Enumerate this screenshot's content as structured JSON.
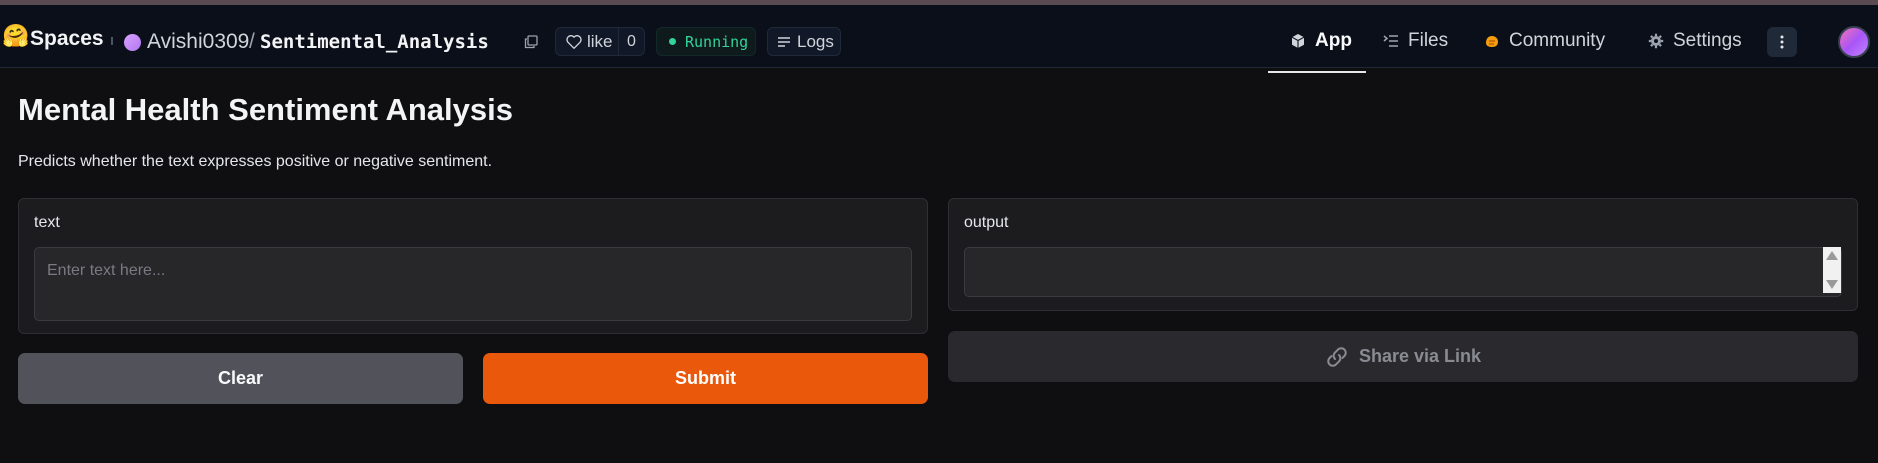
{
  "header": {
    "spaces_label": "Spaces",
    "owner": "Avishi0309",
    "separator": "/",
    "repo": "Sentimental_Analysis",
    "like_label": "like",
    "like_count": "0",
    "status": "Running",
    "logs_label": "Logs",
    "tabs": [
      {
        "label": "App",
        "icon": "cube-icon",
        "active": true
      },
      {
        "label": "Files",
        "icon": "files-icon",
        "active": false
      },
      {
        "label": "Community",
        "icon": "community-icon",
        "active": false
      },
      {
        "label": "Settings",
        "icon": "gear-icon",
        "active": false
      }
    ]
  },
  "main": {
    "title": "Mental Health Sentiment Analysis",
    "description": "Predicts whether the text expresses positive or negative sentiment.",
    "input": {
      "label": "text",
      "placeholder": "Enter text here...",
      "value": ""
    },
    "output": {
      "label": "output",
      "value": ""
    },
    "buttons": {
      "clear": "Clear",
      "submit": "Submit",
      "share": "Share via Link"
    }
  },
  "colors": {
    "background": "#0f0f11",
    "header_bg": "#0b0f19",
    "accent": "#ea580c",
    "running": "#34d399",
    "panel": "#1c1c1f"
  }
}
